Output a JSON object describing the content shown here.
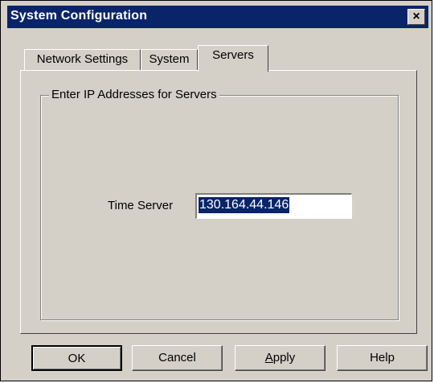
{
  "window": {
    "title_prefix": "System",
    "title_rest": " Configuration",
    "close_glyph": "×"
  },
  "tabs": [
    {
      "label": "Network Settings",
      "active": false
    },
    {
      "label": "System",
      "active": false
    },
    {
      "label": "Servers",
      "active": true
    }
  ],
  "servers_panel": {
    "group_label": "Enter IP Addresses for Servers",
    "time_server_label": "Time Server",
    "time_server_value": "130.164.44.146"
  },
  "buttons": {
    "ok": "OK",
    "cancel": "Cancel",
    "apply_underlined": "A",
    "apply_rest": "pply",
    "help": "Help"
  },
  "colors": {
    "titlebar": "#0a246a",
    "face": "#d4d0c8",
    "selection": "#0a246a"
  },
  "icons": {
    "close": "close-icon"
  }
}
